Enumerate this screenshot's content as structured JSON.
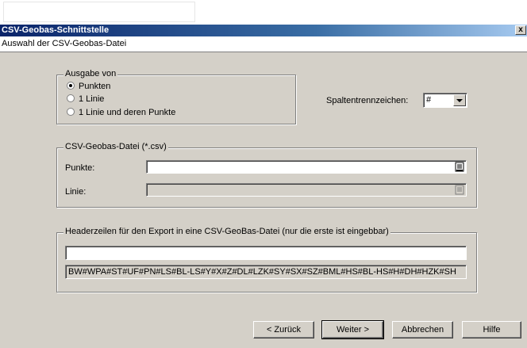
{
  "window": {
    "title": "CSV-Geobas-Schnittstelle",
    "close_glyph": "x"
  },
  "subheader": "Auswahl der CSV-Geobas-Datei",
  "ausgabe": {
    "legend": "Ausgabe von",
    "options": [
      {
        "label": "Punkten",
        "selected": true
      },
      {
        "label": "1 Linie",
        "selected": false
      },
      {
        "label": "1 Linie und deren Punkte",
        "selected": false
      }
    ]
  },
  "separator": {
    "label": "Spaltentrennzeichen:",
    "value": "#"
  },
  "csv": {
    "legend": "CSV-Geobas-Datei (*.csv)",
    "punkte_label": "Punkte:",
    "punkte_value": "",
    "linie_label": "Linie:",
    "linie_value": ""
  },
  "header": {
    "legend": "Headerzeilen für den Export in eine CSV-GeoBas-Datei (nur die erste ist eingebbar)",
    "line1": "",
    "line2": "BW#WPA#ST#UF#PN#LS#BL-LS#Y#X#Z#DL#LZK#SY#SX#SZ#BML#HS#BL-HS#H#DH#HZK#SH"
  },
  "buttons": {
    "back": "< Zurück",
    "next": "Weiter >",
    "cancel": "Abbrechen",
    "help": "Hilfe"
  }
}
